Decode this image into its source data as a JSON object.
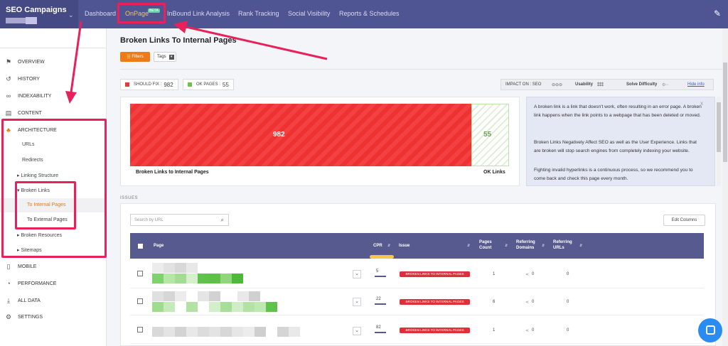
{
  "header": {
    "brand": "SEO Campaigns",
    "nav": [
      "Dashboard",
      "OnPage",
      "InBound Link Analysis",
      "Rank Tracking",
      "Social Visibility",
      "Reports & Schedules"
    ],
    "beta_badge": "BETA"
  },
  "sidebar": {
    "items": [
      {
        "label": "OVERVIEW",
        "icon": "flag-icon"
      },
      {
        "label": "HISTORY",
        "icon": "history-icon"
      },
      {
        "label": "INDEXABILITY",
        "icon": "link-icon"
      },
      {
        "label": "CONTENT",
        "icon": "content-icon"
      },
      {
        "label": "ARCHITECTURE",
        "icon": "sitemap-icon"
      },
      {
        "label": "MOBILE",
        "icon": "mobile-icon"
      },
      {
        "label": "PERFORMANCE",
        "icon": "gauge-icon"
      },
      {
        "label": "ALL DATA",
        "icon": "download-icon"
      },
      {
        "label": "SETTINGS",
        "icon": "gear-icon"
      }
    ],
    "architecture_sub": {
      "urls": "URLs",
      "redirects": "Redirects",
      "linking_structure": "Linking Structure",
      "broken_links": "Broken Links",
      "to_internal": "To Internal Pages",
      "to_external": "To External Pages",
      "broken_resources": "Broken Resources",
      "sitemaps": "Sitemaps"
    }
  },
  "main": {
    "title": "Broken Links To Internal Pages",
    "filters_label": "Filters",
    "tags_label": "Tags",
    "should_fix_label": "SHOULD FIX :",
    "should_fix_value": "982",
    "ok_pages_label": "OK PAGES :",
    "ok_pages_value": "55",
    "impact": {
      "impact_on": "IMPACT ON : SEO",
      "usability": "Usability",
      "solve_difficulty": "Solve Difficulty",
      "hide_info": "Hide info"
    },
    "chart_data": {
      "type": "bar",
      "categories": [
        "Broken Links to Internal Pages",
        "OK Links"
      ],
      "values": [
        982,
        55
      ],
      "colors": [
        "#f03a3a",
        "#dcf0d3"
      ]
    },
    "info": {
      "p1": "A broken link is a link that doesn't work, often resulting in an error page. A broken link happens when the link points to a webpage that has been deleted or moved.",
      "p2": "Broken Links Negatively Affect SEO as well as the User Experience. Links that are broken will stop search engines from completely indexing your website.",
      "p3": "Fighting invalid hyperlinks is a continuous process, so we recommend you to come back and check this page every month.",
      "close": "x"
    },
    "issues_label": "ISSUES",
    "search_placeholder": "Search by URL",
    "edit_columns": "Edit Columns",
    "table": {
      "headers": [
        "Page",
        "CPR",
        "Issue",
        "Pages Count",
        "Referring Domains",
        "Referring URLs"
      ],
      "rows": [
        {
          "cpr": "5",
          "issue": "BROKEN LINKS TO INTERNAL PAGES",
          "pages_count": "1",
          "ref_domains": "0",
          "ref_urls": "0"
        },
        {
          "cpr": "22",
          "issue": "BROKEN LINKS TO INTERNAL PAGES",
          "pages_count": "6",
          "ref_domains": "0",
          "ref_urls": "0"
        },
        {
          "cpr": "82",
          "issue": "BROKEN LINKS TO INTERNAL PAGES",
          "pages_count": "1",
          "ref_domains": "0",
          "ref_urls": "0"
        }
      ]
    }
  },
  "colors": {
    "header": "#4f5492",
    "accent": "#ee7b1a",
    "highlight": "#e8215b",
    "table_header": "#565a8f"
  }
}
